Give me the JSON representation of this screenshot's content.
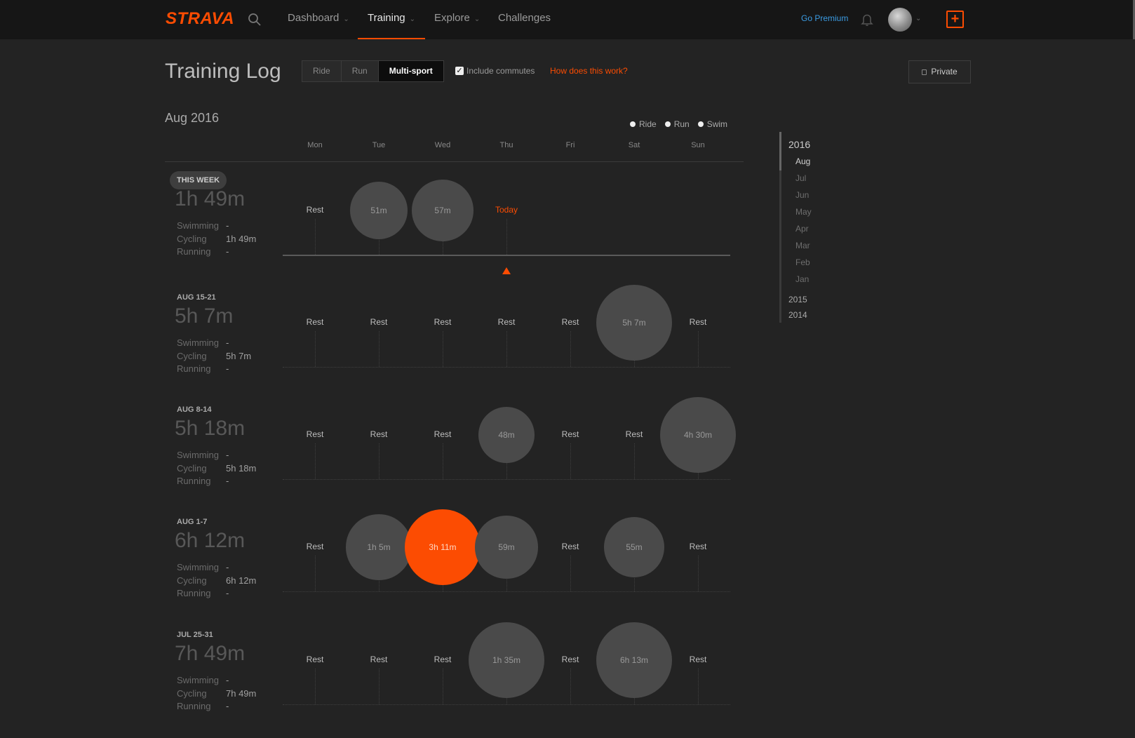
{
  "nav": {
    "logo": "STRAVA",
    "items": [
      {
        "label": "Dashboard",
        "has_caret": true
      },
      {
        "label": "Training",
        "has_caret": true,
        "active": true
      },
      {
        "label": "Explore",
        "has_caret": true
      },
      {
        "label": "Challenges",
        "has_caret": false
      }
    ],
    "go_premium": "Go Premium",
    "upload_icon": "plus-square-icon"
  },
  "header": {
    "title": "Training Log",
    "sport_tabs": [
      "Ride",
      "Run",
      "Multi-sport"
    ],
    "active_tab": "Multi-sport",
    "include_commutes_label": "Include commutes",
    "include_commutes_checked": true,
    "help_link": "How does this work?",
    "privacy_button": "Private"
  },
  "calendar": {
    "month": "Aug 2016",
    "legend": [
      "Ride",
      "Run",
      "Swim"
    ],
    "days": [
      "Mon",
      "Tue",
      "Wed",
      "Thu",
      "Fri",
      "Sat",
      "Sun"
    ],
    "rest_label": "Rest",
    "today_label": "Today",
    "stat_labels": [
      "Swimming",
      "Cycling",
      "Running"
    ],
    "weeks": [
      {
        "label": "THIS WEEK",
        "is_current": true,
        "total": "1h 49m",
        "stats": [
          "-",
          "1h 49m",
          "-"
        ],
        "days": [
          {
            "type": "rest"
          },
          {
            "type": "activity",
            "label": "51m",
            "minutes": 51
          },
          {
            "type": "activity",
            "label": "57m",
            "minutes": 57
          },
          {
            "type": "today"
          },
          {
            "type": "empty"
          },
          {
            "type": "empty"
          },
          {
            "type": "empty"
          }
        ]
      },
      {
        "label": "AUG 15-21",
        "total": "5h 7m",
        "stats": [
          "-",
          "5h 7m",
          "-"
        ],
        "days": [
          {
            "type": "rest"
          },
          {
            "type": "rest"
          },
          {
            "type": "rest"
          },
          {
            "type": "rest"
          },
          {
            "type": "rest"
          },
          {
            "type": "activity",
            "label": "5h 7m",
            "minutes": 307
          },
          {
            "type": "rest"
          }
        ]
      },
      {
        "label": "AUG 8-14",
        "total": "5h 18m",
        "stats": [
          "-",
          "5h 18m",
          "-"
        ],
        "days": [
          {
            "type": "rest"
          },
          {
            "type": "rest"
          },
          {
            "type": "rest"
          },
          {
            "type": "activity",
            "label": "48m",
            "minutes": 48
          },
          {
            "type": "rest"
          },
          {
            "type": "rest"
          },
          {
            "type": "activity",
            "label": "4h 30m",
            "minutes": 270
          }
        ]
      },
      {
        "label": "AUG 1-7",
        "total": "6h 12m",
        "stats": [
          "-",
          "6h 12m",
          "-"
        ],
        "days": [
          {
            "type": "rest"
          },
          {
            "type": "activity",
            "label": "1h 5m",
            "minutes": 65
          },
          {
            "type": "activity",
            "label": "3h 11m",
            "minutes": 191,
            "highlight": true
          },
          {
            "type": "activity",
            "label": "59m",
            "minutes": 59
          },
          {
            "type": "rest"
          },
          {
            "type": "activity",
            "label": "55m",
            "minutes": 55
          },
          {
            "type": "rest"
          }
        ]
      },
      {
        "label": "JUL 25-31",
        "total": "7h 49m",
        "stats": [
          "-",
          "7h 49m",
          "-"
        ],
        "days": [
          {
            "type": "rest"
          },
          {
            "type": "rest"
          },
          {
            "type": "rest"
          },
          {
            "type": "activity",
            "label": "1h 35m",
            "minutes": 95
          },
          {
            "type": "rest"
          },
          {
            "type": "activity",
            "label": "6h 13m",
            "minutes": 373
          },
          {
            "type": "rest"
          }
        ]
      }
    ]
  },
  "timeline": {
    "years": [
      {
        "year": "2016",
        "months": [
          "Aug",
          "Jul",
          "Jun",
          "May",
          "Apr",
          "Mar",
          "Feb",
          "Jan"
        ],
        "active_month": "Aug"
      },
      {
        "year": "2015",
        "months": []
      },
      {
        "year": "2014",
        "months": []
      }
    ]
  },
  "colors": {
    "brand": "#fc4c02",
    "premium_link": "#3b9be2",
    "bubble": "#4a4a4a",
    "background": "#232323"
  }
}
